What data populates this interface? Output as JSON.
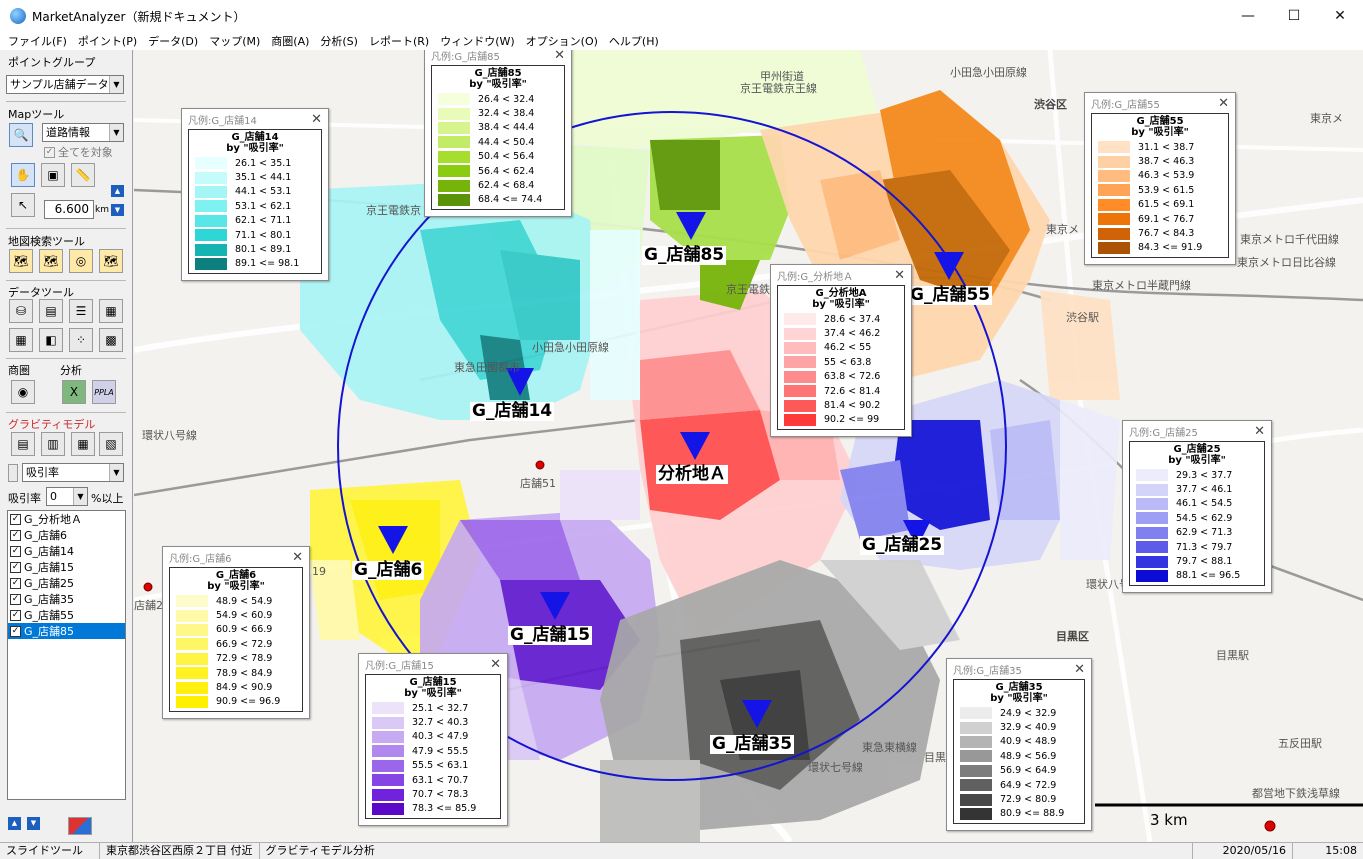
{
  "window": {
    "title": "MarketAnalyzer（新規ドキュメント）",
    "minimize": "—",
    "maximize": "☐",
    "close": "✕"
  },
  "menu": [
    "ファイル(F)",
    "ポイント(P)",
    "データ(D)",
    "マップ(M)",
    "商圏(A)",
    "分析(S)",
    "レポート(R)",
    "ウィンドウ(W)",
    "オプション(O)",
    "ヘルプ(H)"
  ],
  "sidebar": {
    "point_group_label": "ポイントグループ",
    "point_group_value": "サンプル店舗データ2",
    "map_tools_label": "Mapツール",
    "road_info_value": "道路情報",
    "all_target_label": "全てを対象",
    "distance_value": "6.600",
    "distance_unit": "km",
    "geo_search_label": "地図検索ツール",
    "data_tools_label": "データツール",
    "trade_area_label": "商圏",
    "analysis_label": "分析",
    "gravity_label": "グラビティモデル",
    "metric_value": "吸引率",
    "threshold_label": "吸引率",
    "threshold_value": "0",
    "threshold_suffix": "%以上",
    "layers": [
      {
        "label": "G_分析地Ａ",
        "checked": true,
        "selected": false
      },
      {
        "label": "G_店舗6",
        "checked": true,
        "selected": false
      },
      {
        "label": "G_店舗14",
        "checked": true,
        "selected": false
      },
      {
        "label": "G_店舗15",
        "checked": true,
        "selected": false
      },
      {
        "label": "G_店舗25",
        "checked": true,
        "selected": false
      },
      {
        "label": "G_店舗35",
        "checked": true,
        "selected": false
      },
      {
        "label": "G_店舗55",
        "checked": true,
        "selected": false
      },
      {
        "label": "G_店舗85",
        "checked": true,
        "selected": true
      }
    ]
  },
  "map": {
    "scale_label": "3 km",
    "place_labels": [
      {
        "text": "渋谷区",
        "bold": true
      },
      {
        "text": "目黒区",
        "bold": true
      },
      {
        "text": "甲州街道"
      },
      {
        "text": "京王電鉄京王線"
      },
      {
        "text": "小田急小田原線"
      },
      {
        "text": "京王電鉄京"
      },
      {
        "text": "東急田園都市"
      },
      {
        "text": "小田急小田原線"
      },
      {
        "text": "京王電鉄井"
      },
      {
        "text": "環状八号線"
      },
      {
        "text": "店舗51"
      },
      {
        "text": "店舗2"
      },
      {
        "text": "19"
      },
      {
        "text": "東京メ"
      },
      {
        "text": "東京メトロ千代田線"
      },
      {
        "text": "東京メトロ日比谷線"
      },
      {
        "text": "東京メトロ半蔵門線"
      },
      {
        "text": "渋谷駅"
      },
      {
        "text": "環状八号線"
      },
      {
        "text": "目黒駅"
      },
      {
        "text": "五反田駅"
      },
      {
        "text": "東急東横線"
      },
      {
        "text": "環状七号線"
      },
      {
        "text": "都営地下鉄浅草線"
      },
      {
        "text": "目黒"
      },
      {
        "text": "東京メ"
      }
    ],
    "store_labels": [
      "G_店舗85",
      "G_店舗55",
      "G_店舗14",
      "分析地Ａ",
      "G_店舗25",
      "G_店舗6",
      "G_店舗15",
      "G_店舗35"
    ]
  },
  "legends": [
    {
      "header": "凡例:G_店舗14",
      "title": "G_店舗14",
      "subtitle": "by \"吸引率\"",
      "colors": [
        "#e6ffff",
        "#c4fbfb",
        "#a4f6f6",
        "#7ef1f1",
        "#58e6e6",
        "#2ed6d6",
        "#16b3b3",
        "#0e7f7f"
      ],
      "ranges": [
        "26.1 < 35.1",
        "35.1 < 44.1",
        "44.1 < 53.1",
        "53.1 < 62.1",
        "62.1 < 71.1",
        "71.1 < 80.1",
        "80.1 < 89.1",
        "89.1 <= 98.1"
      ]
    },
    {
      "header": "凡例:G_店舗85",
      "title": "G_店舗85",
      "subtitle": "by \"吸引率\"",
      "colors": [
        "#f6ffdc",
        "#e8fbb8",
        "#d6f48e",
        "#c2ec66",
        "#a6de30",
        "#8acd10",
        "#76b40a",
        "#5a9208"
      ],
      "ranges": [
        "26.4 < 32.4",
        "32.4 < 38.4",
        "38.4 < 44.4",
        "44.4 < 50.4",
        "50.4 < 56.4",
        "56.4 < 62.4",
        "62.4 < 68.4",
        "68.4 <= 74.4"
      ]
    },
    {
      "header": "凡例:G_分析地Ａ",
      "title": "G_分析地A",
      "subtitle": "by \"吸引率\"",
      "colors": [
        "#ffeaea",
        "#ffd4d4",
        "#ffbcbc",
        "#ffa4a4",
        "#ff8c8c",
        "#ff7474",
        "#ff5858",
        "#ff3838"
      ],
      "ranges": [
        "28.6 < 37.4",
        "37.4 < 46.2",
        "46.2 < 55",
        "55 < 63.8",
        "63.8 < 72.6",
        "72.6 < 81.4",
        "81.4 < 90.2",
        "90.2 <= 99"
      ]
    },
    {
      "header": "凡例:G_店舗55",
      "title": "G_店舗55",
      "subtitle": "by \"吸引率\"",
      "colors": [
        "#ffe2c6",
        "#ffd0a4",
        "#ffbc7e",
        "#ffa456",
        "#ff8c26",
        "#ec7408",
        "#d06208",
        "#ac5204"
      ],
      "ranges": [
        "31.1 < 38.7",
        "38.7 < 46.3",
        "46.3 < 53.9",
        "53.9 < 61.5",
        "61.5 < 69.1",
        "69.1 < 76.7",
        "76.7 < 84.3",
        "84.3 <= 91.9"
      ]
    },
    {
      "header": "凡例:G_店舗25",
      "title": "G_店舗25",
      "subtitle": "by \"吸引率\"",
      "colors": [
        "#ececfc",
        "#d4d4fa",
        "#babaf8",
        "#9e9ef4",
        "#8080f0",
        "#5c5ce8",
        "#3434e0",
        "#0c0cd6"
      ],
      "ranges": [
        "29.3 < 37.7",
        "37.7 < 46.1",
        "46.1 < 54.5",
        "54.5 < 62.9",
        "62.9 < 71.3",
        "71.3 < 79.7",
        "79.7 < 88.1",
        "88.1 <= 96.5"
      ]
    },
    {
      "header": "凡例:G_店舗6",
      "title": "G_店舗6",
      "subtitle": "by \"吸引率\"",
      "colors": [
        "#fffccc",
        "#fffaaa",
        "#fff888",
        "#fff666",
        "#fff444",
        "#fff222",
        "#fff010",
        "#fff000"
      ],
      "ranges": [
        "48.9 < 54.9",
        "54.9 < 60.9",
        "60.9 < 66.9",
        "66.9 < 72.9",
        "72.9 < 78.9",
        "78.9 < 84.9",
        "84.9 < 90.9",
        "90.9 <= 96.9"
      ]
    },
    {
      "header": "凡例:G_店舗15",
      "title": "G_店舗15",
      "subtitle": "by \"吸引率\"",
      "colors": [
        "#ece2fa",
        "#dac8f6",
        "#c6aaf2",
        "#b088ee",
        "#9c66ea",
        "#8644e4",
        "#7022dc",
        "#5c08c8"
      ],
      "ranges": [
        "25.1 < 32.7",
        "32.7 < 40.3",
        "40.3 < 47.9",
        "47.9 < 55.5",
        "55.5 < 63.1",
        "63.1 < 70.7",
        "70.7 < 78.3",
        "78.3 <= 85.9"
      ]
    },
    {
      "header": "凡例:G_店舗35",
      "title": "G_店舗35",
      "subtitle": "by \"吸引率\"",
      "colors": [
        "#ececec",
        "#d0d0d0",
        "#b4b4b4",
        "#989898",
        "#7c7c7c",
        "#606060",
        "#484848",
        "#343434"
      ],
      "ranges": [
        "24.9 < 32.9",
        "32.9 < 40.9",
        "40.9 < 48.9",
        "48.9 < 56.9",
        "56.9 < 64.9",
        "64.9 < 72.9",
        "72.9 < 80.9",
        "80.9 <= 88.9"
      ]
    }
  ],
  "status": {
    "mode": "スライドツール",
    "address": "東京都渋谷区西原２丁目 付近",
    "analysis": "グラビティモデル分析",
    "date": "2020/05/16",
    "time": "15:08"
  }
}
